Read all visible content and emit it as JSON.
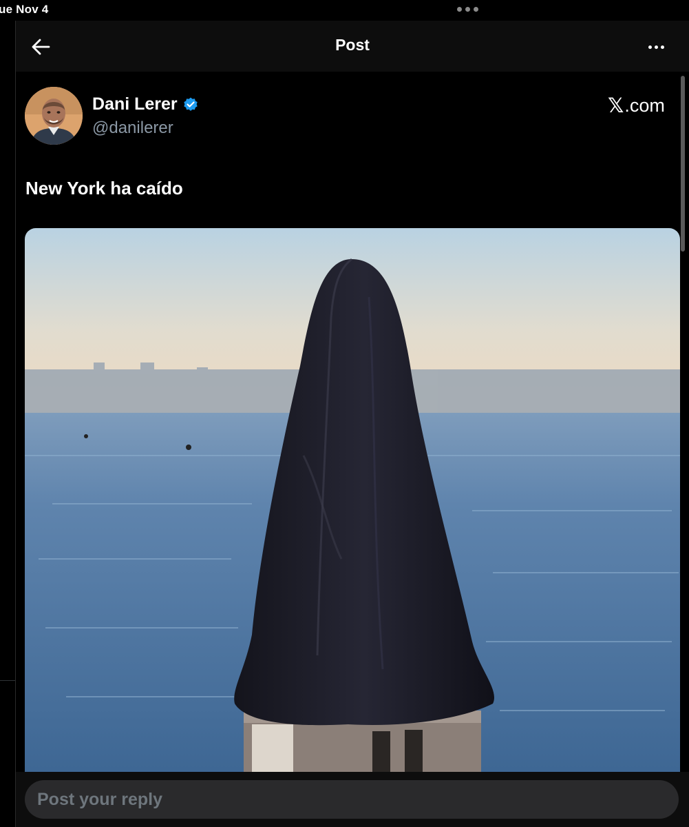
{
  "status_bar": {
    "time": "ue Nov 4"
  },
  "header": {
    "title": "Post",
    "back_icon": "arrow-left-icon",
    "more_icon": "ellipsis-icon"
  },
  "post": {
    "author_name": "Dani Lerer",
    "author_handle": "@danilerer",
    "verified": true,
    "verified_color": "#1d9bf0",
    "source": {
      "glyph": "𝕏",
      "suffix": ".com"
    },
    "text": "New York ha caído",
    "media": {
      "description_icon": "photo"
    }
  },
  "reply": {
    "placeholder": "Post your reply"
  },
  "colors": {
    "background": "#000000",
    "header_background": "#0d0d0d",
    "secondary_text": "#8b98a5",
    "reply_field": "#2a2a2c"
  }
}
